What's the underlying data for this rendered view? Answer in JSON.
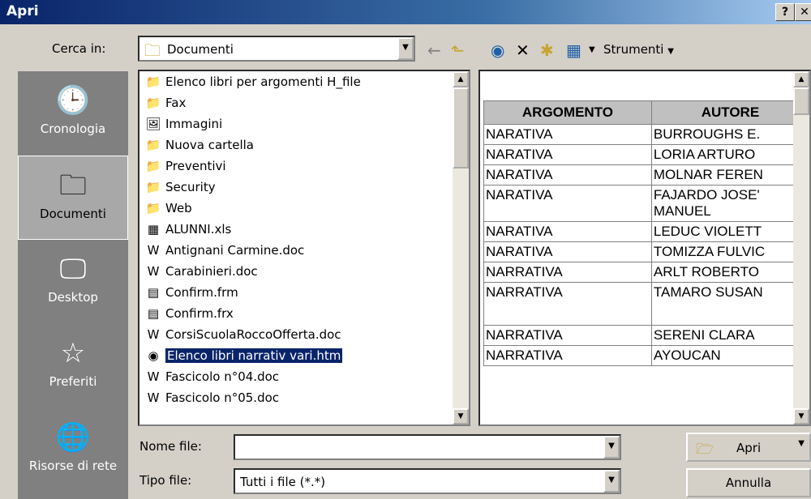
{
  "window": {
    "title": "Apri",
    "help_label": "?",
    "close_label": "✕"
  },
  "toolbar": {
    "look_in_label": "Cerca in:",
    "look_in_value": "Documenti",
    "tools_label": "Strumenti"
  },
  "places": [
    {
      "label": "Cronologia"
    },
    {
      "label": "Documenti"
    },
    {
      "label": "Desktop"
    },
    {
      "label": "Preferiti"
    },
    {
      "label": "Risorse di rete"
    }
  ],
  "files": [
    {
      "name": "Elenco libri per argomenti H_file",
      "icon": "📁"
    },
    {
      "name": "Fax",
      "icon": "📁"
    },
    {
      "name": "Immagini",
      "icon": "🖼"
    },
    {
      "name": "Nuova cartella",
      "icon": "📁"
    },
    {
      "name": "Preventivi",
      "icon": "📁"
    },
    {
      "name": "Security",
      "icon": "📁"
    },
    {
      "name": "Web",
      "icon": "📁"
    },
    {
      "name": "ALUNNI.xls",
      "icon": "▦"
    },
    {
      "name": "Antignani Carmine.doc",
      "icon": "W"
    },
    {
      "name": "Carabinieri.doc",
      "icon": "W"
    },
    {
      "name": "Confirm.frm",
      "icon": "▤"
    },
    {
      "name": "Confirm.frx",
      "icon": "▤"
    },
    {
      "name": "CorsiScuolaRoccoOfferta.doc",
      "icon": "W"
    },
    {
      "name": "Elenco libri narrativ vari.htm",
      "icon": "◉"
    },
    {
      "name": "Fascicolo n°04.doc",
      "icon": "W"
    },
    {
      "name": "Fascicolo n°05.doc",
      "icon": "W"
    }
  ],
  "preview": {
    "headers": [
      "ARGOMENTO",
      "AUTORE"
    ],
    "rows": [
      [
        "NARATIVA",
        "BURROUGHS E."
      ],
      [
        "NARATIVA",
        "LORIA ARTURO"
      ],
      [
        "NARATIVA",
        "MOLNAR FEREN"
      ],
      [
        "NARATIVA",
        "FAJARDO JOSE' MANUEL"
      ],
      [
        "NARATIVA",
        "LEDUC VIOLETT"
      ],
      [
        "NARATIVA",
        "TOMIZZA FULVIC"
      ],
      [
        "NARRATIVA",
        "ARLT ROBERTO"
      ],
      [
        "NARRATIVA",
        "TAMARO SUSAN"
      ],
      [
        "NARRATIVA",
        "SERENI CLARA"
      ],
      [
        "NARRATIVA",
        "AYOUCAN"
      ]
    ]
  },
  "bottom": {
    "filename_label": "Nome file:",
    "filename_value": "",
    "filetype_label": "Tipo file:",
    "filetype_value": "Tutti i file (*.*)",
    "open_label": "Apri",
    "cancel_label": "Annulla"
  }
}
